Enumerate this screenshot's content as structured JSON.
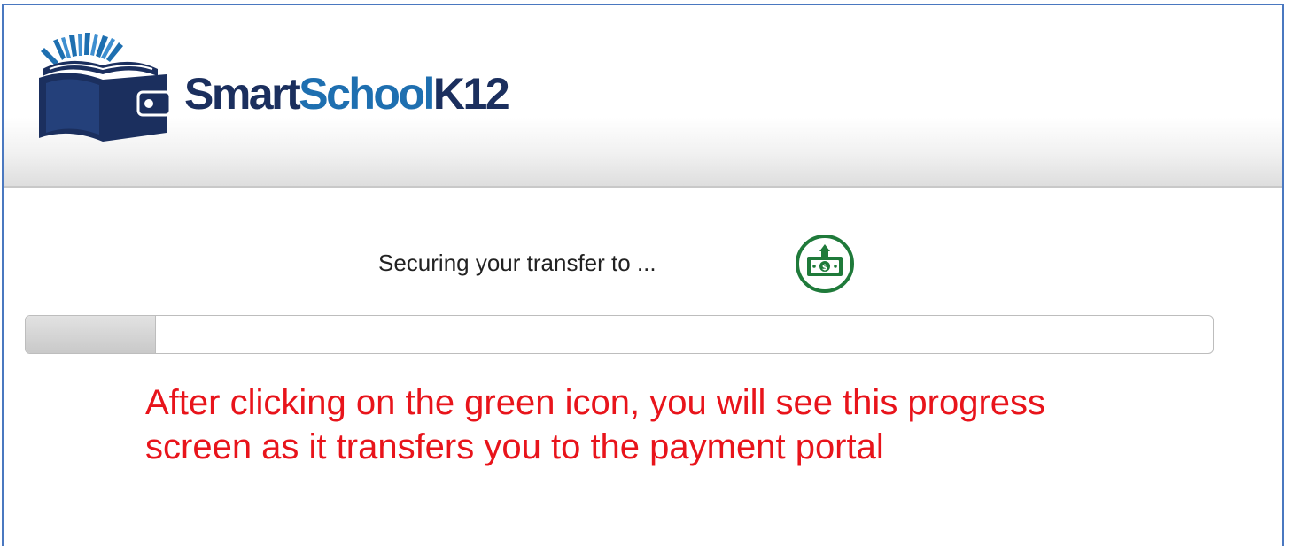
{
  "brand": {
    "name_part1": "Smart",
    "name_part2": "School",
    "name_part3": "K12",
    "icon": "book-wallet-logo-icon",
    "colors": {
      "dark": "#1b2f5e",
      "blue": "#1e6fb0"
    }
  },
  "status": {
    "text": "Securing your transfer to ...",
    "icon": "money-bill-icon",
    "icon_color": "#1f7a3a"
  },
  "progress": {
    "fraction": 0.11
  },
  "annotation": {
    "line1": "After clicking on the green icon, you will see this progress",
    "line2": "screen as it transfers you to the payment portal",
    "color": "#e8141b"
  }
}
